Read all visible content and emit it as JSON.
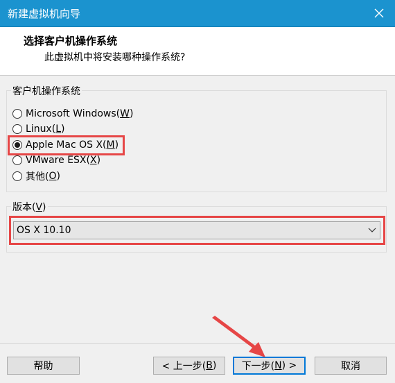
{
  "window": {
    "title": "新建虚拟机向导"
  },
  "header": {
    "heading": "选择客户机操作系统",
    "subheading": "此虚拟机中将安装哪种操作系统?"
  },
  "os_group": {
    "label": "客户机操作系统",
    "options": [
      {
        "text": "Microsoft Windows(",
        "key": "W",
        "suffix": ")",
        "selected": false
      },
      {
        "text": "Linux(",
        "key": "L",
        "suffix": ")",
        "selected": false
      },
      {
        "text": "Apple Mac OS X(",
        "key": "M",
        "suffix": ")",
        "selected": true
      },
      {
        "text": "VMware ESX(",
        "key": "X",
        "suffix": ")",
        "selected": false
      },
      {
        "text": "其他(",
        "key": "O",
        "suffix": ")",
        "selected": false
      }
    ]
  },
  "version_group": {
    "label_text": "版本(",
    "label_key": "V",
    "label_suffix": ")",
    "selected_value": "OS X 10.10"
  },
  "buttons": {
    "help": "帮助",
    "back_text": "< 上一步(",
    "back_key": "B",
    "back_suffix": ")",
    "next_text": "下一步(",
    "next_key": "N",
    "next_suffix": ") >",
    "cancel": "取消"
  },
  "colors": {
    "titlebar": "#1b93cf",
    "highlight": "#e64646",
    "focus": "#0078d7"
  }
}
